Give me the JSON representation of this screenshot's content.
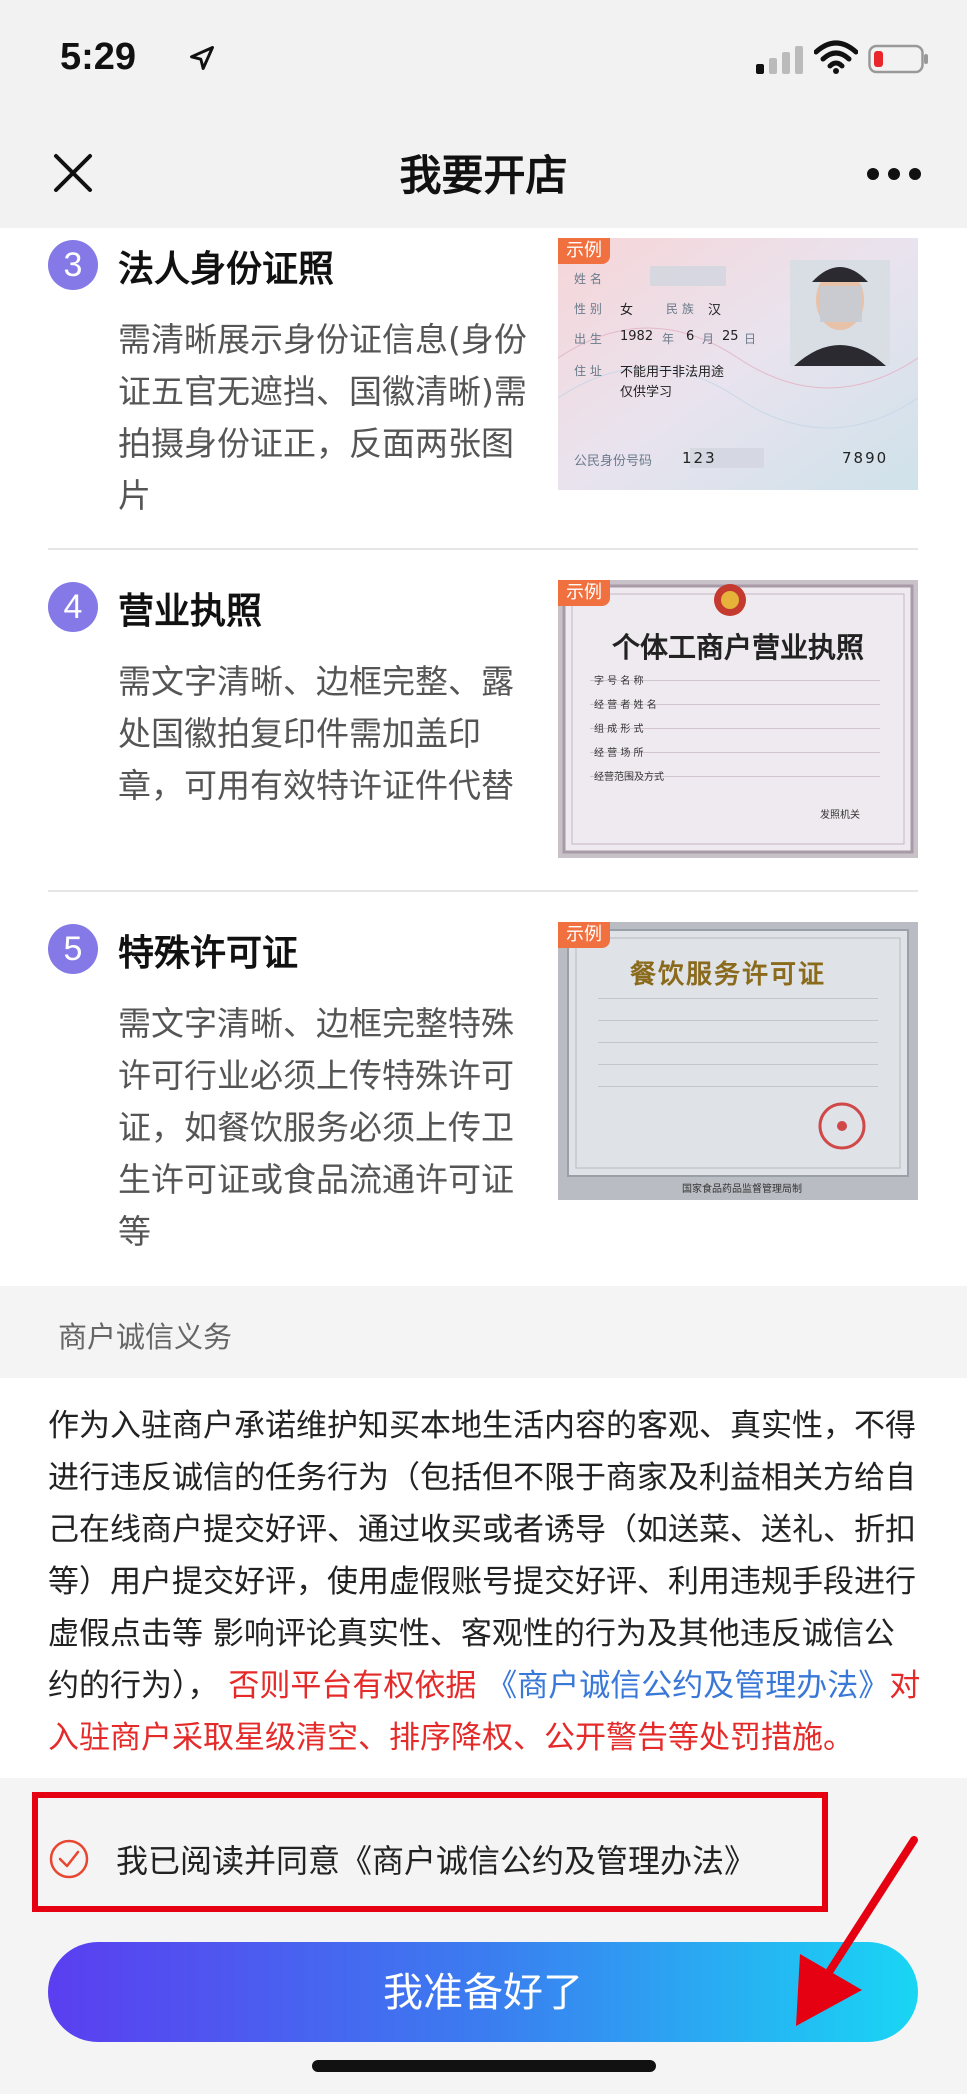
{
  "status_bar": {
    "time": "5:29"
  },
  "nav": {
    "title": "我要开店"
  },
  "sample_badge": "示例",
  "steps": [
    {
      "number": "3",
      "title": "法人身份证照",
      "description": "需清晰展示身份证信息(身份证五官无遮挡、国徽清晰)需拍摄身份证正，反面两张图片"
    },
    {
      "number": "4",
      "title": "营业执照",
      "description": "需文字清晰、边框完整、露处国徽拍复印件需加盖印章，可用有效特许证件代替"
    },
    {
      "number": "5",
      "title": "特殊许可证",
      "description": "需文字清晰、边框完整特殊许可行业必须上传特殊许可证，如餐饮服务必须上传卫生许可证或食品流通许可证等"
    }
  ],
  "id_card": {
    "name_label": "姓 名",
    "sex_label": "性 别",
    "sex": "女",
    "ethnic_label": "民 族",
    "ethnic": "汉",
    "birth_label": "出 生",
    "birth_year": "1982",
    "birth_month_label": "年",
    "birth_month": "6",
    "birth_day_label": "月",
    "birth_day": "25",
    "birth_end": "日",
    "address_label": "住 址",
    "address_1": "不能用于非法用途",
    "address_2": "仅供学习",
    "id_label": "公民身份号码",
    "id_start": "123",
    "id_end": "7890"
  },
  "license": {
    "title": "个体工商户营业执照",
    "fields": [
      "字 号 名 称",
      "经 营 者 姓 名",
      "组 成 形 式",
      "经 营 场 所",
      "经营范围及方式"
    ],
    "issuer": "发照机关"
  },
  "food_permit": {
    "title": "餐饮服务许可证",
    "footer": "国家食品药品监督管理局制"
  },
  "section": {
    "title": "商户诚信义务"
  },
  "obligation": {
    "normal": "作为入驻商户承诺维护知买本地生活内容的客观、真实性，不得进行违反诚信的任务行为（包括但不限于商家及利益相关方给自己在线商户提交好评、通过收买或者诱导（如送菜、送礼、折扣等）用户提交好评，使用虚假账号提交好评、利用违规手段进行虚假点击等 影响评论真实性、客观性的行为及其他违反诚信公约的行为），",
    "red_1": " 否则平台有权依据 ",
    "link": "《商户诚信公约及管理办法》",
    "red_2": "对入驻商户采取星级清空、排序降权、公开警告等处罚措施。"
  },
  "agree": {
    "text": "我已阅读并同意《商户诚信公约及管理办法》"
  },
  "ready_button": {
    "label": "我准备好了"
  },
  "colors": {
    "step_badge": "#8479e6",
    "highlight_red": "#e50012",
    "warning_red": "#e52a2a",
    "link_blue": "#3a78d8",
    "button_gradient_start": "#5b3ef0",
    "button_gradient_end": "#19d6f4"
  },
  "icons": [
    "location-arrow-icon",
    "signal-icon",
    "wifi-icon",
    "battery-icon",
    "close-icon",
    "more-icon",
    "check-circle-icon",
    "red-arrow-icon"
  ]
}
